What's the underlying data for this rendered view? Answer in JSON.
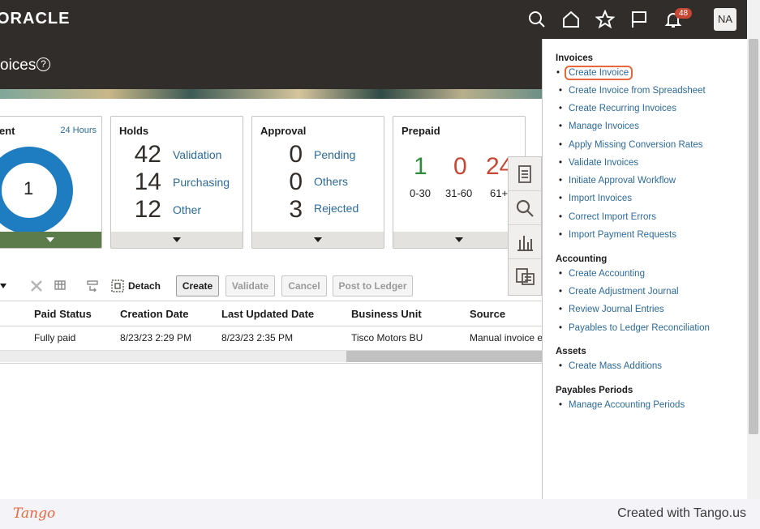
{
  "header": {
    "logo": "ORACLE",
    "notification_count": "48",
    "avatar_initials": "NA"
  },
  "page": {
    "title": "oices",
    "help": "?"
  },
  "cards": {
    "recent": {
      "title": "ent",
      "time_link": "24 Hours",
      "center_value": "1"
    },
    "holds": {
      "title": "Holds",
      "rows": [
        {
          "count": "42",
          "label": "Validation"
        },
        {
          "count": "14",
          "label": "Purchasing"
        },
        {
          "count": "12",
          "label": "Other"
        }
      ]
    },
    "approval": {
      "title": "Approval",
      "rows": [
        {
          "count": "0",
          "label": "Pending"
        },
        {
          "count": "0",
          "label": "Others"
        },
        {
          "count": "3",
          "label": "Rejected"
        }
      ]
    },
    "prepaid": {
      "title": "Prepaid",
      "values": [
        {
          "value": "1",
          "range": "0-30",
          "color": "#2e8b3a"
        },
        {
          "value": "0",
          "range": "31-60",
          "color": "#c74634"
        },
        {
          "value": "24",
          "range": "61+",
          "color": "#c74634"
        }
      ]
    }
  },
  "toolbar": {
    "detach_label": "Detach",
    "create_label": "Create",
    "validate_label": "Validate",
    "cancel_label": "Cancel",
    "post_label": "Post to Ledger"
  },
  "table": {
    "columns": [
      "Paid Status",
      "Creation Date",
      "Last Updated Date",
      "Business Unit",
      "Source"
    ],
    "rows": [
      [
        "Fully paid",
        "8/23/23 2:29 PM",
        "8/23/23 2:35 PM",
        "Tisco Motors BU",
        "Manual invoice e"
      ]
    ]
  },
  "menu": {
    "invoices_heading": "Invoices",
    "invoices": [
      "Create Invoice",
      "Create Invoice from Spreadsheet",
      "Create Recurring Invoices",
      "Manage Invoices",
      "Apply Missing Conversion Rates",
      "Validate Invoices",
      "Initiate Approval Workflow",
      "Import Invoices",
      "Correct Import Errors",
      "Import Payment Requests"
    ],
    "accounting_heading": "Accounting",
    "accounting": [
      "Create Accounting",
      "Create Adjustment Journal",
      "Review Journal Entries",
      "Payables to Ledger Reconciliation"
    ],
    "assets_heading": "Assets",
    "assets": [
      "Create Mass Additions"
    ],
    "periods_heading": "Payables Periods",
    "periods": [
      "Manage Accounting Periods"
    ]
  },
  "footer": {
    "brand": "Tango",
    "created_with": "Created with Tango.us"
  },
  "colors": {
    "header_bg": "#312d2a",
    "link": "#2c6a9a",
    "highlight": "#e8673c",
    "donut": "#1e7cc0",
    "recent_footer": "#5d7c4b"
  }
}
